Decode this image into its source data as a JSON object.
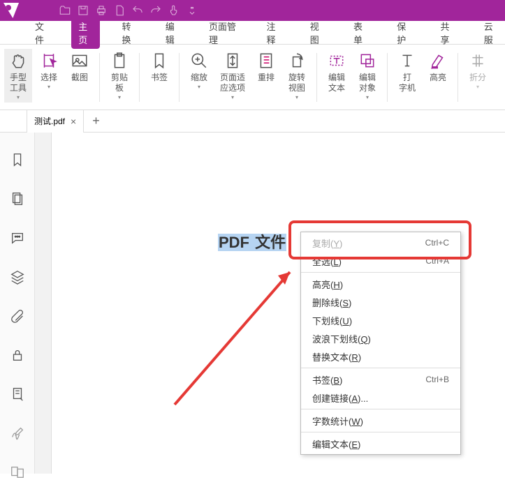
{
  "menu": [
    "文件",
    "主页",
    "转换",
    "编辑",
    "页面管理",
    "注释",
    "视图",
    "表单",
    "保护",
    "共享",
    "云服"
  ],
  "active_menu": 1,
  "ribbon": [
    {
      "id": "hand",
      "label": "手型\n工具",
      "drop": true,
      "sel": true
    },
    {
      "id": "select",
      "label": "选择",
      "drop": true,
      "accent": true
    },
    {
      "id": "snap",
      "label": "截图"
    },
    {
      "id": "clip",
      "label": "剪贴\n板",
      "drop": true
    },
    {
      "id": "bookmark",
      "label": "书签"
    },
    {
      "id": "zoom",
      "label": "缩放",
      "drop": true
    },
    {
      "id": "pagefit",
      "label": "页面适\n应选项",
      "drop": true
    },
    {
      "id": "reflow",
      "label": "重排"
    },
    {
      "id": "rotate",
      "label": "旋转\n视图",
      "drop": true
    },
    {
      "id": "edittext",
      "label": "编辑\n文本",
      "accent": true
    },
    {
      "id": "editobj",
      "label": "编辑\n对象",
      "drop": true,
      "accent": true
    },
    {
      "id": "type",
      "label": "打\n字机"
    },
    {
      "id": "highlight",
      "label": "高亮",
      "accent": true
    },
    {
      "id": "collapse",
      "label": "折分",
      "drop": true
    }
  ],
  "tab": {
    "title": "测试.pdf"
  },
  "doc_text": {
    "t1": "PDF ",
    "t2": "文件"
  },
  "context_menu": [
    {
      "t": "item",
      "label": "复制",
      "mn": "Y",
      "sc": "Ctrl+C",
      "disabled": true
    },
    {
      "t": "item",
      "label": "全选",
      "mn": "L",
      "sc": "Ctrl+A"
    },
    {
      "t": "sep"
    },
    {
      "t": "item",
      "label": "高亮",
      "mn": "H"
    },
    {
      "t": "item",
      "label": "删除线",
      "mn": "S"
    },
    {
      "t": "item",
      "label": "下划线",
      "mn": "U"
    },
    {
      "t": "item",
      "label": "波浪下划线",
      "mn": "Q"
    },
    {
      "t": "item",
      "label": "替换文本",
      "mn": "R"
    },
    {
      "t": "sep"
    },
    {
      "t": "item",
      "label": "书签",
      "mn": "B",
      "sc": "Ctrl+B"
    },
    {
      "t": "item",
      "label": "创建链接",
      "mn": "A",
      "suffix": "..."
    },
    {
      "t": "sep"
    },
    {
      "t": "item",
      "label": "字数统计",
      "mn": "W"
    },
    {
      "t": "sep"
    },
    {
      "t": "item",
      "label": "编辑文本",
      "mn": "E"
    }
  ]
}
